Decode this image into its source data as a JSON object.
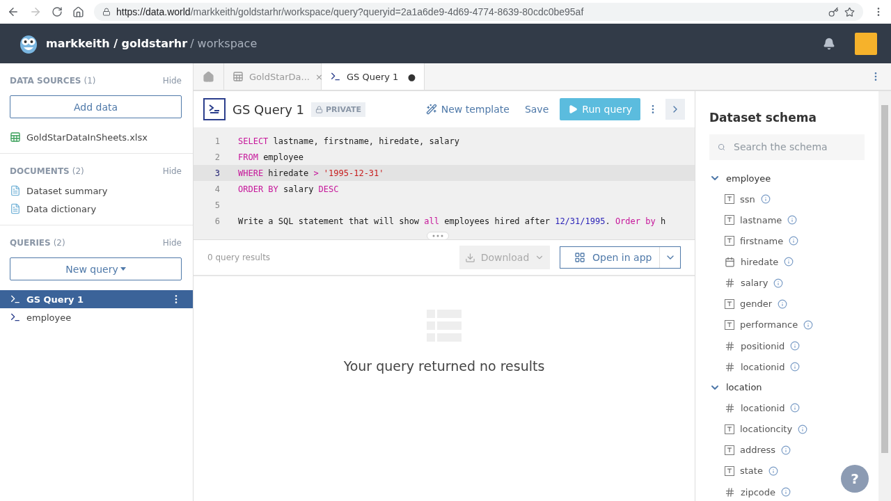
{
  "browser": {
    "url_host": "https://data.world",
    "url_path": "/markkeith/goldstarhr/workspace/query?queryid=2a1a6de9-4d69-4774-8639-80cdc0be95af"
  },
  "header": {
    "owner": "markkeith",
    "separator": "/",
    "dataset": "goldstarhr",
    "section": "/ workspace"
  },
  "sidebar": {
    "sections": [
      {
        "kind": "sources",
        "title": "DATA SOURCES",
        "count": "(1)",
        "hide": "Hide",
        "button": "Add data",
        "items": [
          {
            "label": "GoldStarDataInSheets.xlsx",
            "selected": false
          }
        ]
      },
      {
        "kind": "documents",
        "title": "DOCUMENTS",
        "count": "(2)",
        "hide": "Hide",
        "items": [
          {
            "label": "Dataset summary",
            "selected": false
          },
          {
            "label": "Data dictionary",
            "selected": false
          }
        ]
      },
      {
        "kind": "queries",
        "title": "QUERIES",
        "count": "(2)",
        "hide": "Hide",
        "button": "New query",
        "items": [
          {
            "label": "GS Query 1",
            "selected": true
          },
          {
            "label": "employee",
            "selected": false
          }
        ]
      }
    ]
  },
  "tabs": [
    {
      "kind": "table",
      "label": "GoldStarDa...",
      "selected": false,
      "close": "×"
    },
    {
      "kind": "query",
      "label": "GS Query 1",
      "selected": true,
      "close": "●"
    }
  ],
  "query": {
    "title": "GS Query 1",
    "visibility": "PRIVATE",
    "new_template": "New template",
    "save": "Save",
    "run": "Run query"
  },
  "editor": {
    "lines": [
      {
        "number": "1",
        "active": false,
        "tokens": [
          {
            "kind": "keyword",
            "text": "SELECT"
          },
          {
            "kind": "plain",
            "text": " lastname, firstname, hiredate, salary"
          }
        ]
      },
      {
        "number": "2",
        "active": false,
        "tokens": [
          {
            "kind": "keyword",
            "text": "FROM"
          },
          {
            "kind": "plain",
            "text": " employee"
          }
        ]
      },
      {
        "number": "3",
        "active": true,
        "tokens": [
          {
            "kind": "keyword",
            "text": "WHERE"
          },
          {
            "kind": "plain",
            "text": " hiredate "
          },
          {
            "kind": "keyword",
            "text": ">"
          },
          {
            "kind": "string",
            "text": " '1995-12-31'"
          }
        ]
      },
      {
        "number": "4",
        "active": false,
        "tokens": [
          {
            "kind": "keyword",
            "text": "ORDER BY"
          },
          {
            "kind": "plain",
            "text": " salary "
          },
          {
            "kind": "keyword",
            "text": "DESC"
          }
        ]
      },
      {
        "number": "5",
        "active": false
      },
      {
        "number": "6",
        "active": false,
        "tokens": [
          {
            "kind": "plain",
            "text": "Write a SQL statement that will show "
          },
          {
            "kind": "keyword",
            "text": "all"
          },
          {
            "kind": "plain",
            "text": " employees hired after "
          },
          {
            "kind": "number",
            "text": "12/31/1995"
          },
          {
            "kind": "plain",
            "text": ". "
          },
          {
            "kind": "keyword",
            "text": "Order by"
          },
          {
            "kind": "plain",
            "text": " h"
          }
        ]
      }
    ]
  },
  "results": {
    "count": "0 query results",
    "download": "Download",
    "open_in_app": "Open in app",
    "empty": "Your query returned no results"
  },
  "schema": {
    "title": "Dataset schema",
    "search_placeholder": "Search the schema",
    "tables": [
      {
        "name": "employee",
        "expanded": true,
        "columns": [
          {
            "name": "ssn",
            "kind": "text"
          },
          {
            "name": "lastname",
            "kind": "text"
          },
          {
            "name": "firstname",
            "kind": "text"
          },
          {
            "name": "hiredate",
            "kind": "date"
          },
          {
            "name": "salary",
            "kind": "number"
          },
          {
            "name": "gender",
            "kind": "text"
          },
          {
            "name": "performance",
            "kind": "text"
          },
          {
            "name": "positionid",
            "kind": "number"
          },
          {
            "name": "locationid",
            "kind": "number"
          }
        ]
      },
      {
        "name": "location",
        "expanded": true,
        "columns": [
          {
            "name": "locationid",
            "kind": "number"
          },
          {
            "name": "locationcity",
            "kind": "text"
          },
          {
            "name": "address",
            "kind": "text"
          },
          {
            "name": "state",
            "kind": "text"
          },
          {
            "name": "zipcode",
            "kind": "number"
          }
        ]
      }
    ]
  },
  "help": "?"
}
